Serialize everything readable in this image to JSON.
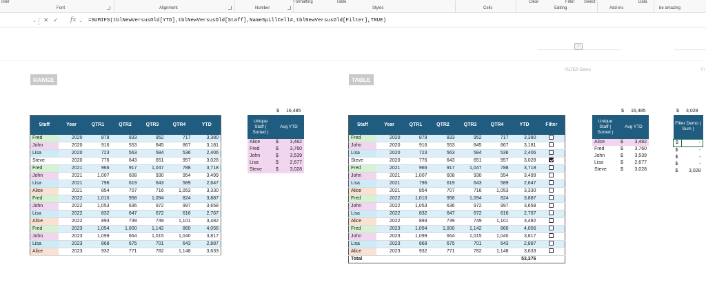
{
  "ribbon": {
    "top_labels": [
      "inter",
      "Formatting",
      "Table",
      "Clear",
      "Filter",
      "Select",
      "Data",
      "be amazing"
    ],
    "groups": [
      "Font",
      "Alignment",
      "Number",
      "Styles",
      "Cells",
      "Editing",
      "Add-ins",
      "be amazing"
    ]
  },
  "formula_bar": {
    "formula": "=SUMIFS(tblNewVersusOld[YTD],tblNewVersusOld[Staff],NameSpillCell#,tblNewVersusOld[Filter],TRUE)",
    "fx_label": "fx",
    "cancel_glyph": "✕",
    "enter_glyph": "✓"
  },
  "faint_labels": {
    "filter_demo": "FILTER Demo",
    "edge": "Fi"
  },
  "range_section": {
    "title": "RANGE",
    "columns": [
      "Staff",
      "Year",
      "QTR1",
      "QTR2",
      "QTR3",
      "QTR4",
      "YTD"
    ],
    "rows": [
      {
        "staff": "Fred",
        "year": "2020",
        "q1": "878",
        "q2": "833",
        "q3": "952",
        "q4": "717",
        "ytd": "3,380",
        "color": "fred"
      },
      {
        "staff": "John",
        "year": "2020",
        "q1": "916",
        "q2": "553",
        "q3": "845",
        "q4": "867",
        "ytd": "3,181",
        "color": "john"
      },
      {
        "staff": "Lisa",
        "year": "2020",
        "q1": "723",
        "q2": "563",
        "q3": "584",
        "q4": "536",
        "ytd": "2,406",
        "color": "lisa"
      },
      {
        "staff": "Steve",
        "year": "2020",
        "q1": "776",
        "q2": "643",
        "q3": "651",
        "q4": "957",
        "ytd": "3,028",
        "color": "steve"
      },
      {
        "staff": "Fred",
        "year": "2021",
        "q1": "966",
        "q2": "917",
        "q3": "1,047",
        "q4": "788",
        "ytd": "3,718",
        "color": "fred"
      },
      {
        "staff": "John",
        "year": "2021",
        "q1": "1,007",
        "q2": "608",
        "q3": "930",
        "q4": "954",
        "ytd": "3,499",
        "color": "john"
      },
      {
        "staff": "Lisa",
        "year": "2021",
        "q1": "796",
        "q2": "619",
        "q3": "643",
        "q4": "589",
        "ytd": "2,647",
        "color": "lisa"
      },
      {
        "staff": "Alice",
        "year": "2021",
        "q1": "854",
        "q2": "707",
        "q3": "716",
        "q4": "1,053",
        "ytd": "3,330",
        "color": "alice"
      },
      {
        "staff": "Fred",
        "year": "2022",
        "q1": "1,010",
        "q2": "958",
        "q3": "1,094",
        "q4": "824",
        "ytd": "3,887",
        "color": "fred"
      },
      {
        "staff": "John",
        "year": "2022",
        "q1": "1,053",
        "q2": "636",
        "q3": "972",
        "q4": "997",
        "ytd": "3,658",
        "color": "john"
      },
      {
        "staff": "Lisa",
        "year": "2022",
        "q1": "832",
        "q2": "647",
        "q3": "672",
        "q4": "616",
        "ytd": "2,767",
        "color": "lisa"
      },
      {
        "staff": "Alice",
        "year": "2022",
        "q1": "893",
        "q2": "739",
        "q3": "749",
        "q4": "1,101",
        "ytd": "3,482",
        "color": "alice"
      },
      {
        "staff": "Fred",
        "year": "2023",
        "q1": "1,054",
        "q2": "1,000",
        "q3": "1,142",
        "q4": "860",
        "ytd": "4,056",
        "color": "fred"
      },
      {
        "staff": "John",
        "year": "2023",
        "q1": "1,099",
        "q2": "664",
        "q3": "1,015",
        "q4": "1,040",
        "ytd": "3,817",
        "color": "john"
      },
      {
        "staff": "Lisa",
        "year": "2023",
        "q1": "868",
        "q2": "675",
        "q3": "701",
        "q4": "643",
        "ytd": "2,887",
        "color": "lisa"
      },
      {
        "staff": "Alice",
        "year": "2023",
        "q1": "932",
        "q2": "771",
        "q3": "782",
        "q4": "1,148",
        "ytd": "3,633",
        "color": "alice"
      }
    ],
    "sum_total": {
      "cur": "$",
      "value": "16,485"
    },
    "summary": {
      "header_staff": "Unique Staff ( Sorted )",
      "header_avg": "Avg YTD",
      "rows": [
        {
          "name": "Alice",
          "cur": "$",
          "amt": "3,482"
        },
        {
          "name": "Fred",
          "cur": "$",
          "amt": "3,760"
        },
        {
          "name": "John",
          "cur": "$",
          "amt": "3,539"
        },
        {
          "name": "Lisa",
          "cur": "$",
          "amt": "2,677"
        },
        {
          "name": "Steve",
          "cur": "$",
          "amt": "3,028"
        }
      ]
    }
  },
  "table_section": {
    "title": "TABLE",
    "columns": [
      "Staff",
      "Year",
      "QTR1",
      "QTR2",
      "QTR3",
      "QTR4",
      "YTD",
      "Filter"
    ],
    "filters": [
      false,
      false,
      false,
      true,
      false,
      false,
      false,
      false,
      false,
      false,
      false,
      false,
      false,
      false,
      false,
      false
    ],
    "total_label": "Total",
    "total_value": "53,376",
    "sum_total": {
      "cur": "$",
      "value": "16,485"
    },
    "summary": {
      "header_staff": "Unique Staff ( Sorted )",
      "header_avg": "Avg YTD",
      "rows": [
        {
          "name": "Alice",
          "cur": "$",
          "amt": "3,482"
        },
        {
          "name": "Fred",
          "cur": "$",
          "amt": "3,760"
        },
        {
          "name": "John",
          "cur": "$",
          "amt": "3,539"
        },
        {
          "name": "Lisa",
          "cur": "$",
          "amt": "2,677"
        },
        {
          "name": "Steve",
          "cur": "$",
          "amt": "3,028"
        }
      ]
    },
    "filter_demo": {
      "sum_total": {
        "cur": "$",
        "value": "3,028"
      },
      "header": "Filter Demo ( Sum )",
      "rows": [
        {
          "cur": "$",
          "amt": "-"
        },
        {
          "cur": "$",
          "amt": "-"
        },
        {
          "cur": "$",
          "amt": "-"
        },
        {
          "cur": "$",
          "amt": "-"
        },
        {
          "cur": "$",
          "amt": "3,028"
        }
      ]
    }
  },
  "colors": {
    "header_blue": "#1f5c80",
    "fred": "#d6f2d3",
    "john": "#f2d6ef",
    "lisa": "#cfeaf7",
    "alice": "#fbe1d2",
    "band": "#dceef8"
  }
}
